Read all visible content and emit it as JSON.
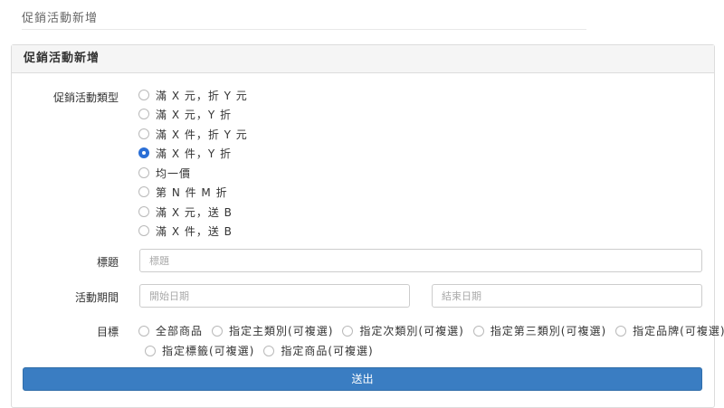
{
  "page": {
    "title": "促銷活動新增"
  },
  "panel": {
    "title": "促銷活動新增"
  },
  "form": {
    "type_label": "促銷活動類型",
    "type_options": [
      {
        "label": "滿 X 元，折 Y 元",
        "checked": false
      },
      {
        "label": "滿 X 元，Y 折",
        "checked": false
      },
      {
        "label": "滿 X 件，折 Y 元",
        "checked": false
      },
      {
        "label": "滿 X 件，Y 折",
        "checked": true
      },
      {
        "label": "均一價",
        "checked": false
      },
      {
        "label": "第 N 件 M 折",
        "checked": false
      },
      {
        "label": "滿 X 元，送 B",
        "checked": false
      },
      {
        "label": "滿 X 件，送 B",
        "checked": false
      }
    ],
    "title_label": "標題",
    "title_placeholder": "標題",
    "period_label": "活動期間",
    "start_placeholder": "開始日期",
    "end_placeholder": "結束日期",
    "target_label": "目標",
    "target_options": [
      "全部商品",
      "指定主類別(可複選)",
      "指定次類別(可複選)",
      "指定第三類別(可複選)",
      "指定品牌(可複選)",
      "指定標籤(可複選)",
      "指定商品(可複選)"
    ],
    "submit_label": "送出"
  },
  "colors": {
    "primary": "#3a7dc2",
    "radio_checked": "#2b6fd6"
  }
}
